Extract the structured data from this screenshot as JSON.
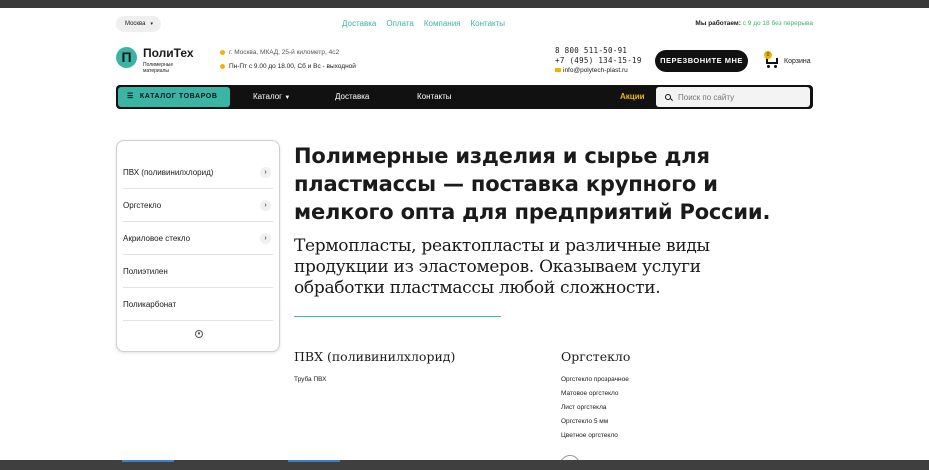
{
  "topbar": {
    "city": "Москва",
    "nav": [
      "Доставка",
      "Оплата",
      "Компания",
      "Контакты"
    ],
    "hours_label": "Мы работаем:",
    "hours_value": "с 9 до 18 без перерыва"
  },
  "header": {
    "logo_letter": "П",
    "logo_name": "ПолиТех",
    "logo_sub": "Полимерные материалы",
    "address": "г. Москва, МКАД, 25-й километр, 4с2",
    "schedule": "Пн-Пт с 9.00 до 18.00, Сб и Вс - выходной",
    "phone1": "8 800 511-50-91",
    "phone2": "+7 (495) 134-15-19",
    "email": "info@polytech-plast.ru",
    "callback_label": "ПЕРЕЗВОНИТЕ МНЕ",
    "cart_count": "0",
    "cart_label": "Корзина"
  },
  "navbar": {
    "catalog_label": "КАТАЛОГ ТОВАРОВ",
    "items": [
      "Каталог",
      "Доставка",
      "Контакты"
    ],
    "promo_label": "Акции",
    "search_placeholder": "Поиск по сайту"
  },
  "sidebar": {
    "items": [
      {
        "label": "ПВХ (поливинилхлорид)",
        "has_children": true
      },
      {
        "label": "Оргстекло",
        "has_children": true
      },
      {
        "label": "Акриловое стекло",
        "has_children": true
      },
      {
        "label": "Полиэтилен",
        "has_children": false
      },
      {
        "label": "Поликарбонат",
        "has_children": false
      }
    ]
  },
  "main": {
    "title": "Полимерные изделия и сырье для пластмассы — поставка крупного и мелкого опта для предприятий России.",
    "subtitle": "Термопласты, реактопласты и различные виды продукции из эластомеров. Оказываем услуги обработки пластмассы любой сложности.",
    "categories": [
      {
        "title": "ПВХ (поливинилхлорид)",
        "links": [
          "Труба ПВХ"
        ]
      },
      {
        "title": "Оргстекло",
        "links": [
          "Оргстекло прозрачное",
          "Матовое оргстекло",
          "Лист оргстекла",
          "Оргстекло 5 мм",
          "Цветное оргстекло"
        ]
      }
    ]
  },
  "colors": {
    "accent": "#3bb5a3",
    "promo": "#f0b400",
    "dark": "#111111"
  }
}
